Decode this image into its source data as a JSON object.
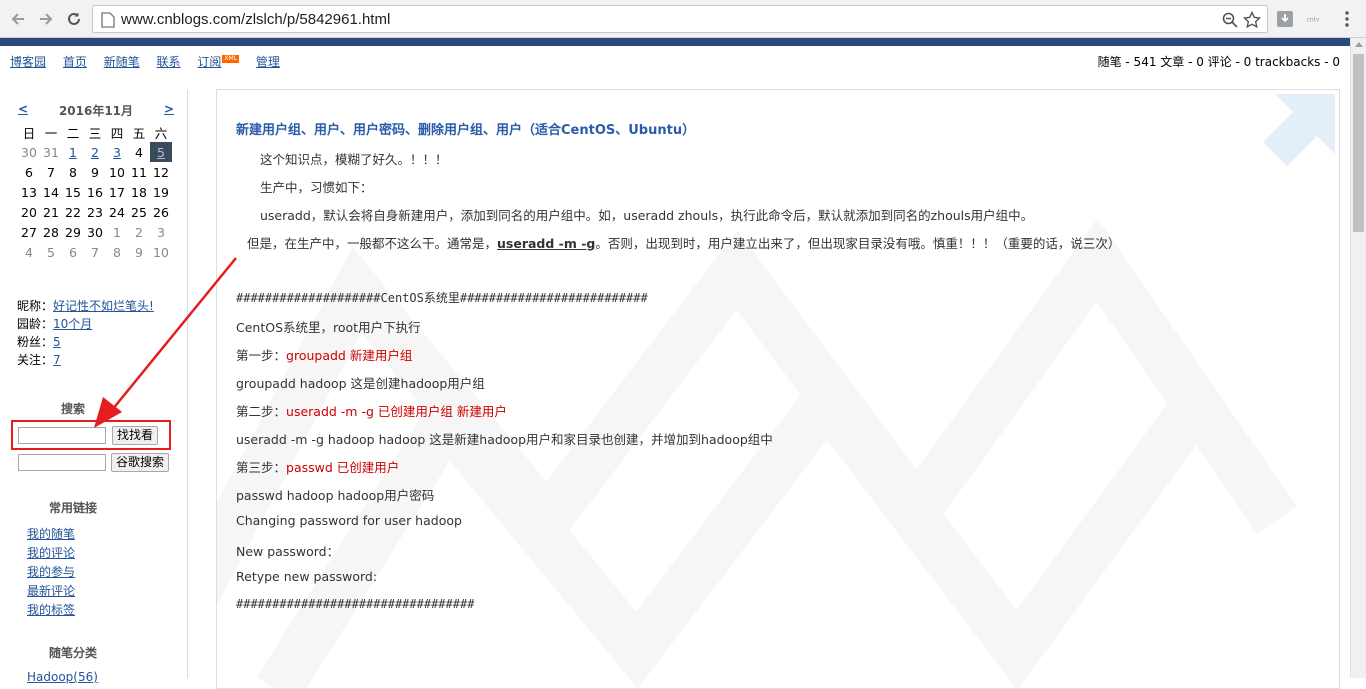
{
  "browser": {
    "url": "www.cnblogs.com/zlslch/p/5842961.html"
  },
  "topnav": {
    "items": [
      "博客园",
      "首页",
      "新随笔",
      "联系",
      "订阅",
      "管理"
    ],
    "xml_badge": "XML",
    "stats": "随笔 - 541  文章 - 0  评论 - 0  trackbacks - 0"
  },
  "calendar": {
    "prev": "<",
    "next": ">",
    "title": "2016年11月",
    "weekdays": [
      "日",
      "一",
      "二",
      "三",
      "四",
      "五",
      "六"
    ],
    "rows": [
      [
        "30",
        "31",
        "1",
        "2",
        "3",
        "4",
        "5"
      ],
      [
        "6",
        "7",
        "8",
        "9",
        "10",
        "11",
        "12"
      ],
      [
        "13",
        "14",
        "15",
        "16",
        "17",
        "18",
        "19"
      ],
      [
        "20",
        "21",
        "22",
        "23",
        "24",
        "25",
        "26"
      ],
      [
        "27",
        "28",
        "29",
        "30",
        "1",
        "2",
        "3"
      ],
      [
        "4",
        "5",
        "6",
        "7",
        "8",
        "9",
        "10"
      ]
    ]
  },
  "profile": {
    "nickname_label": "昵称：",
    "nickname": "好记性不如烂笔头!",
    "age_label": "园龄：",
    "age": "10个月",
    "fans_label": "粉丝：",
    "fans": "5",
    "follow_label": "关注：",
    "follow": "7"
  },
  "search": {
    "title": "搜索",
    "button1": "找找看",
    "button2": "谷歌搜索"
  },
  "links": {
    "title": "常用链接",
    "items": [
      "我的随笔",
      "我的评论",
      "我的参与",
      "最新评论",
      "我的标签"
    ]
  },
  "categories": {
    "title": "随笔分类",
    "first_item": "Hadoop(56)"
  },
  "post": {
    "title": "新建用户组、用户、用户密码、删除用户组、用户（适合CentOS、Ubuntu）",
    "p1": "这个知识点，模糊了好久。！！！",
    "p2": "生产中，习惯如下：",
    "p3": "useradd，默认会将自身新建用户，添加到同名的用户组中。如，useradd zhouls，执行此命令后，默认就添加到同名的zhouls用户组中。",
    "p4_a": "但是，在生产中，一般都不这么干。通常是，",
    "p4_b": "useradd -m -g",
    "p4_c": "。否则，出现到时，用户建立出来了，但出现家目录没有哦。慎重！！！（重要的话，说三次）",
    "hash_head": "####################CentOS系统里##########################",
    "l1": "CentOS系统里，root用户下执行",
    "step1_label": "第一步：",
    "step1_text": "groupadd  新建用户组",
    "l2": "groupadd hadoop      这是创建hadoop用户组",
    "step2_label": "第二步：",
    "step2_text": "useradd  -m  -g   已创建用户组   新建用户",
    "l3": "useradd  -m -g hadoop hadoop     这是新建hadoop用户和家目录也创建，并增加到hadoop组中",
    "step3_label": "第三步：",
    "step3_text": "passwd  已创建用户",
    "l4": "passwd hadoop      hadoop用户密码",
    "l5": "Changing password  for user hadoop",
    "l6": "New password：",
    "l7": "Retype new password:",
    "hash_tail": "#################################"
  },
  "colors": {
    "blue_bar": "#2a4a7c",
    "link": "#225599",
    "title": "#2a5caa",
    "highlight_red": "#e41e1e"
  }
}
